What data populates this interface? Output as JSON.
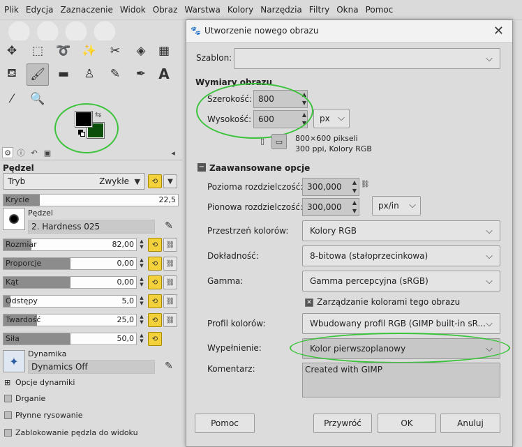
{
  "menubar": [
    "Plik",
    "Edycja",
    "Zaznaczenie",
    "Widok",
    "Obraz",
    "Warstwa",
    "Kolory",
    "Narzędzia",
    "Filtry",
    "Okna",
    "Pomoc"
  ],
  "tool_options": {
    "title": "Pędzel",
    "mode_label": "Tryb",
    "mode_value": "Zwykłe",
    "opacity_label": "Krycie",
    "opacity_value": "22,5",
    "brush_label": "Pędzel",
    "brush_value": "2. Hardness 025",
    "sliders": [
      {
        "label": "Rozmiar",
        "value": "82,00"
      },
      {
        "label": "Proporcje",
        "value": "0,00"
      },
      {
        "label": "Kąt",
        "value": "0,00"
      },
      {
        "label": "Odstępy",
        "value": "5,0"
      },
      {
        "label": "Twardość",
        "value": "25,0"
      },
      {
        "label": "Siła",
        "value": "50,0"
      }
    ],
    "dynamics_label": "Dynamika",
    "dynamics_value": "Dynamics Off",
    "options": [
      "Opcje dynamiki",
      "Drganie",
      "Płynne rysowanie",
      "Zablokowanie pędzla do widoku"
    ]
  },
  "dialog": {
    "title": "Utworzenie nowego obrazu",
    "template_label": "Szablon:",
    "template_value": "",
    "dims_title": "Wymiary obrazu",
    "width_label": "Szerokość:",
    "width_value": "800",
    "height_label": "Wysokość:",
    "height_value": "600",
    "unit_value": "px",
    "info_line1": "800×600 pikseli",
    "info_line2": "300 ppi, Kolory RGB",
    "advanced_title": "Zaawansowane opcje",
    "xres_label": "Pozioma rozdzielczość:",
    "xres_value": "300,000",
    "yres_label": "Pionowa rozdzielczość:",
    "yres_value": "300,000",
    "res_unit": "px/in",
    "colorspace_label": "Przestrzeń kolorów:",
    "colorspace_value": "Kolory RGB",
    "precision_label": "Dokładność:",
    "precision_value": "8-bitowa (stałoprzecinkowa)",
    "gamma_label": "Gamma:",
    "gamma_value": "Gamma percepcyjna (sRGB)",
    "manage_colors_label": "Zarządzanie kolorami tego obrazu",
    "profile_label": "Profil kolorów:",
    "profile_value": "Wbudowany profil RGB (GIMP built-in sR...",
    "fill_label": "Wypełnienie:",
    "fill_value": "Kolor pierwszoplanowy",
    "comment_label": "Komentarz:",
    "comment_value": "Created with GIMP",
    "buttons": {
      "help": "Pomoc",
      "reset": "Przywróć",
      "ok": "OK",
      "cancel": "Anuluj"
    }
  },
  "colors": {
    "fg": "#000000",
    "bg": "#0b4f0b",
    "annotation": "#3cc33c"
  }
}
